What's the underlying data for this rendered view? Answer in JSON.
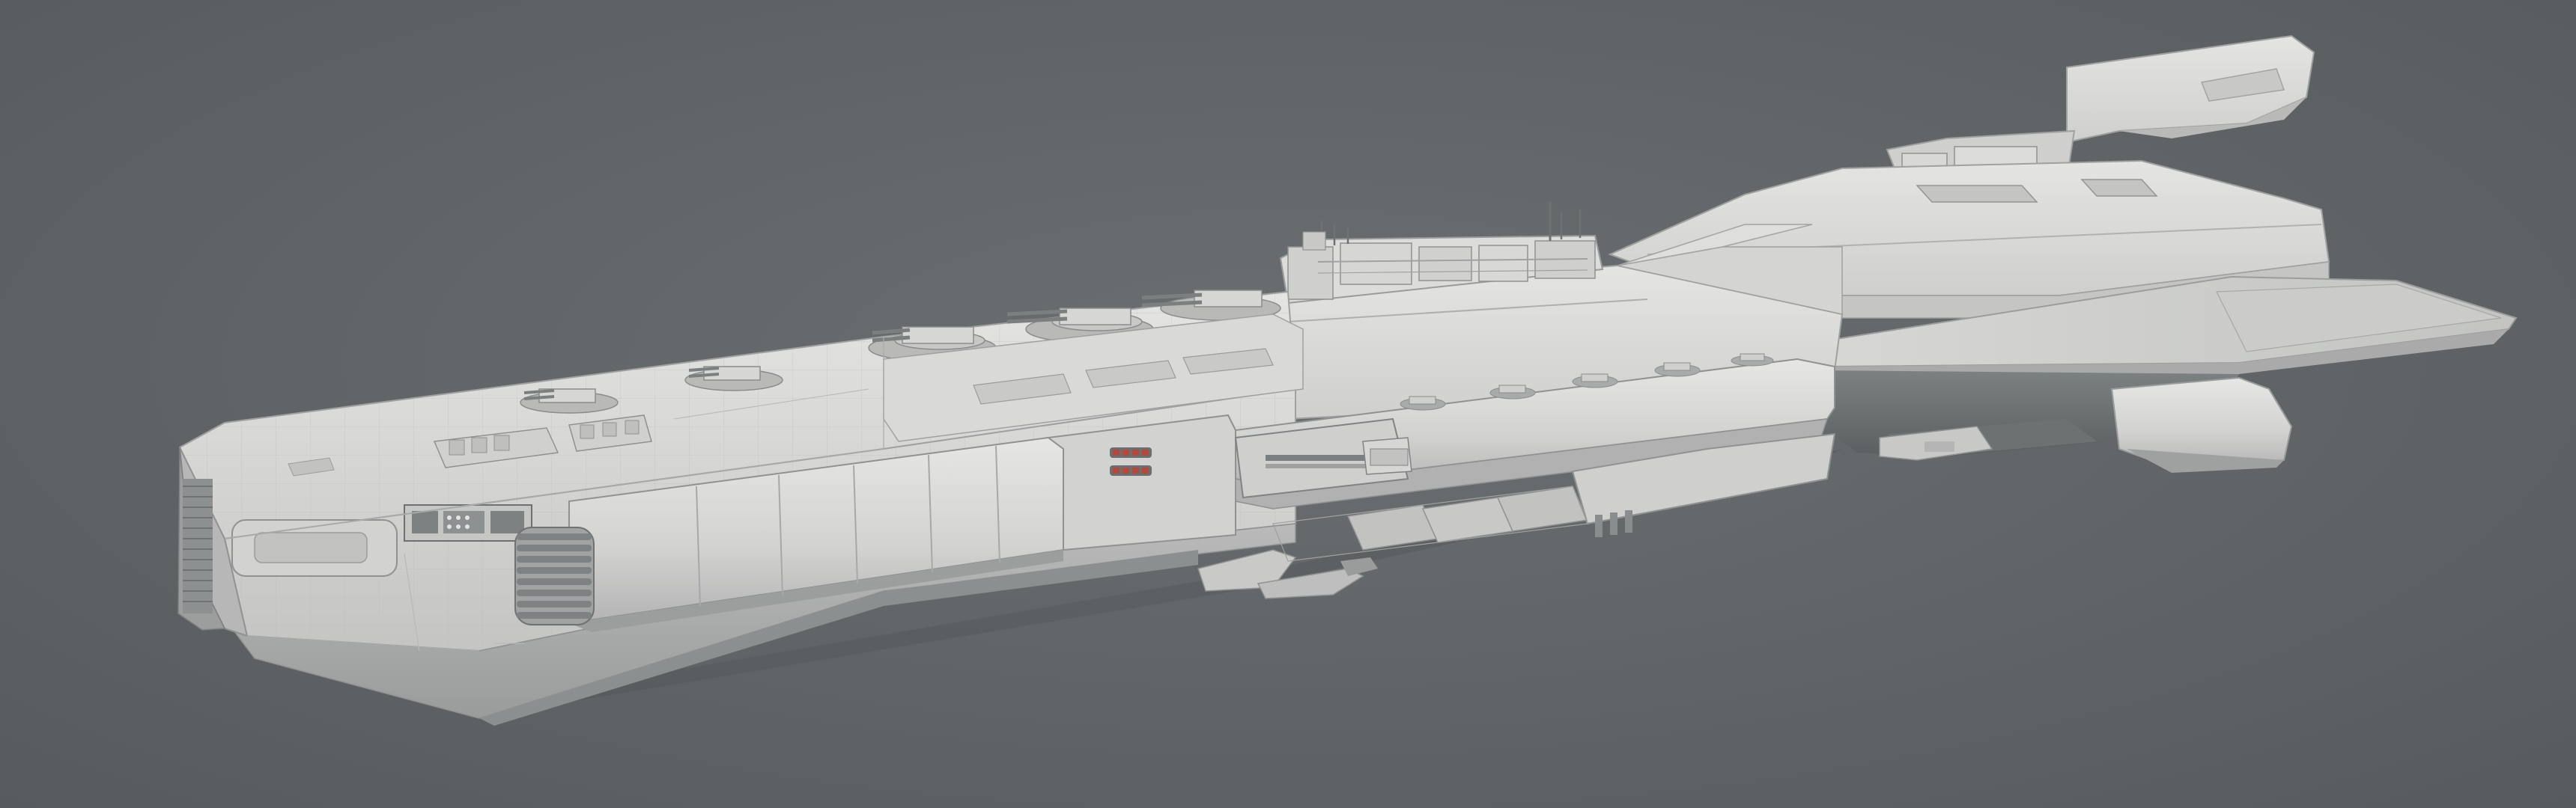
{
  "scene": {
    "subject": "spaceship-3d-model-render",
    "background_color": "#5f6365",
    "hull_color": "#d9d9d7",
    "hull_shadow_color": "#a7a9a9",
    "hull_dark_color": "#7b7f80",
    "accent_color": "#b5483a"
  }
}
